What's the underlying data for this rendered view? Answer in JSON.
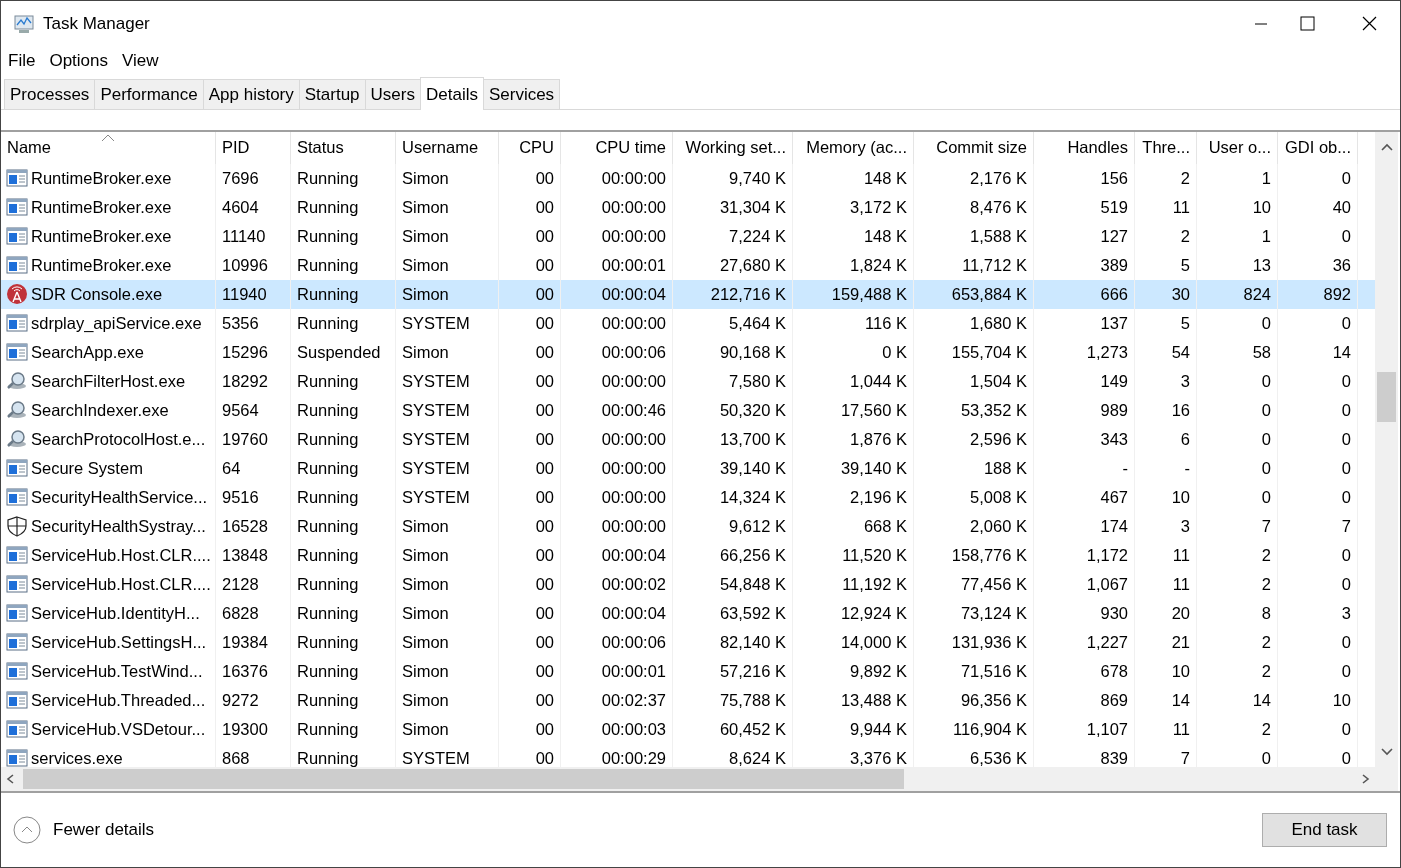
{
  "window": {
    "title": "Task Manager"
  },
  "menu": [
    "File",
    "Options",
    "View"
  ],
  "tabs": [
    {
      "label": "Processes",
      "selected": false
    },
    {
      "label": "Performance",
      "selected": false
    },
    {
      "label": "App history",
      "selected": false
    },
    {
      "label": "Startup",
      "selected": false
    },
    {
      "label": "Users",
      "selected": false
    },
    {
      "label": "Details",
      "selected": true
    },
    {
      "label": "Services",
      "selected": false
    }
  ],
  "table": {
    "columns": [
      {
        "label": "Name",
        "sorted": true
      },
      {
        "label": "PID",
        "sorted": false
      },
      {
        "label": "Status",
        "sorted": false
      },
      {
        "label": "Username",
        "sorted": false
      },
      {
        "label": "CPU",
        "sorted": false
      },
      {
        "label": "CPU time",
        "sorted": false
      },
      {
        "label": "Working set...",
        "sorted": false
      },
      {
        "label": "Memory (ac...",
        "sorted": false
      },
      {
        "label": "Commit size",
        "sorted": false
      },
      {
        "label": "Handles",
        "sorted": false
      },
      {
        "label": "Thre...",
        "sorted": false
      },
      {
        "label": "User o...",
        "sorted": false
      },
      {
        "label": "GDI ob...",
        "sorted": false
      }
    ],
    "rows": [
      {
        "kind": "app",
        "selected": false,
        "cells": [
          "RuntimeBroker.exe",
          "7696",
          "Running",
          "Simon",
          "00",
          "00:00:00",
          "9,740 K",
          "148 K",
          "2,176 K",
          "156",
          "2",
          "1",
          "0"
        ]
      },
      {
        "kind": "app",
        "selected": false,
        "cells": [
          "RuntimeBroker.exe",
          "4604",
          "Running",
          "Simon",
          "00",
          "00:00:00",
          "31,304 K",
          "3,172 K",
          "8,476 K",
          "519",
          "11",
          "10",
          "40"
        ]
      },
      {
        "kind": "app",
        "selected": false,
        "cells": [
          "RuntimeBroker.exe",
          "11140",
          "Running",
          "Simon",
          "00",
          "00:00:00",
          "7,224 K",
          "148 K",
          "1,588 K",
          "127",
          "2",
          "1",
          "0"
        ]
      },
      {
        "kind": "app",
        "selected": false,
        "cells": [
          "RuntimeBroker.exe",
          "10996",
          "Running",
          "Simon",
          "00",
          "00:00:01",
          "27,680 K",
          "1,824 K",
          "11,712 K",
          "389",
          "5",
          "13",
          "36"
        ]
      },
      {
        "kind": "radio",
        "selected": true,
        "cells": [
          "SDR Console.exe",
          "11940",
          "Running",
          "Simon",
          "00",
          "00:00:04",
          "212,716 K",
          "159,488 K",
          "653,884 K",
          "666",
          "30",
          "824",
          "892"
        ]
      },
      {
        "kind": "app",
        "selected": false,
        "cells": [
          "sdrplay_apiService.exe",
          "5356",
          "Running",
          "SYSTEM",
          "00",
          "00:00:00",
          "5,464 K",
          "116 K",
          "1,680 K",
          "137",
          "5",
          "0",
          "0"
        ]
      },
      {
        "kind": "app",
        "selected": false,
        "cells": [
          "SearchApp.exe",
          "15296",
          "Suspended",
          "Simon",
          "00",
          "00:00:06",
          "90,168 K",
          "0 K",
          "155,704 K",
          "1,273",
          "54",
          "58",
          "14"
        ]
      },
      {
        "kind": "search",
        "selected": false,
        "cells": [
          "SearchFilterHost.exe",
          "18292",
          "Running",
          "SYSTEM",
          "00",
          "00:00:00",
          "7,580 K",
          "1,044 K",
          "1,504 K",
          "149",
          "3",
          "0",
          "0"
        ]
      },
      {
        "kind": "search",
        "selected": false,
        "cells": [
          "SearchIndexer.exe",
          "9564",
          "Running",
          "SYSTEM",
          "00",
          "00:00:46",
          "50,320 K",
          "17,560 K",
          "53,352 K",
          "989",
          "16",
          "0",
          "0"
        ]
      },
      {
        "kind": "search",
        "selected": false,
        "cells": [
          "SearchProtocolHost.e...",
          "19760",
          "Running",
          "SYSTEM",
          "00",
          "00:00:00",
          "13,700 K",
          "1,876 K",
          "2,596 K",
          "343",
          "6",
          "0",
          "0"
        ]
      },
      {
        "kind": "app",
        "selected": false,
        "cells": [
          "Secure System",
          "64",
          "Running",
          "SYSTEM",
          "00",
          "00:00:00",
          "39,140 K",
          "39,140 K",
          "188 K",
          "-",
          "-",
          "0",
          "0"
        ]
      },
      {
        "kind": "app",
        "selected": false,
        "cells": [
          "SecurityHealthService...",
          "9516",
          "Running",
          "SYSTEM",
          "00",
          "00:00:00",
          "14,324 K",
          "2,196 K",
          "5,008 K",
          "467",
          "10",
          "0",
          "0"
        ]
      },
      {
        "kind": "shield",
        "selected": false,
        "cells": [
          "SecurityHealthSystray...",
          "16528",
          "Running",
          "Simon",
          "00",
          "00:00:00",
          "9,612 K",
          "668 K",
          "2,060 K",
          "174",
          "3",
          "7",
          "7"
        ]
      },
      {
        "kind": "app",
        "selected": false,
        "cells": [
          "ServiceHub.Host.CLR....",
          "13848",
          "Running",
          "Simon",
          "00",
          "00:00:04",
          "66,256 K",
          "11,520 K",
          "158,776 K",
          "1,172",
          "11",
          "2",
          "0"
        ]
      },
      {
        "kind": "app",
        "selected": false,
        "cells": [
          "ServiceHub.Host.CLR....",
          "2128",
          "Running",
          "Simon",
          "00",
          "00:00:02",
          "54,848 K",
          "11,192 K",
          "77,456 K",
          "1,067",
          "11",
          "2",
          "0"
        ]
      },
      {
        "kind": "app",
        "selected": false,
        "cells": [
          "ServiceHub.IdentityH...",
          "6828",
          "Running",
          "Simon",
          "00",
          "00:00:04",
          "63,592 K",
          "12,924 K",
          "73,124 K",
          "930",
          "20",
          "8",
          "3"
        ]
      },
      {
        "kind": "app",
        "selected": false,
        "cells": [
          "ServiceHub.SettingsH...",
          "19384",
          "Running",
          "Simon",
          "00",
          "00:00:06",
          "82,140 K",
          "14,000 K",
          "131,936 K",
          "1,227",
          "21",
          "2",
          "0"
        ]
      },
      {
        "kind": "app",
        "selected": false,
        "cells": [
          "ServiceHub.TestWind...",
          "16376",
          "Running",
          "Simon",
          "00",
          "00:00:01",
          "57,216 K",
          "9,892 K",
          "71,516 K",
          "678",
          "10",
          "2",
          "0"
        ]
      },
      {
        "kind": "app",
        "selected": false,
        "cells": [
          "ServiceHub.Threaded...",
          "9272",
          "Running",
          "Simon",
          "00",
          "00:02:37",
          "75,788 K",
          "13,488 K",
          "96,356 K",
          "869",
          "14",
          "14",
          "10"
        ]
      },
      {
        "kind": "app",
        "selected": false,
        "cells": [
          "ServiceHub.VSDetour...",
          "19300",
          "Running",
          "Simon",
          "00",
          "00:00:03",
          "60,452 K",
          "9,944 K",
          "116,904 K",
          "1,107",
          "11",
          "2",
          "0"
        ]
      },
      {
        "kind": "app",
        "selected": false,
        "cells": [
          "services.exe",
          "868",
          "Running",
          "SYSTEM",
          "00",
          "00:00:29",
          "8,624 K",
          "3,376 K",
          "6,536 K",
          "839",
          "7",
          "0",
          "0"
        ]
      }
    ]
  },
  "footer": {
    "toggle": "Fewer details",
    "button": "End task"
  }
}
